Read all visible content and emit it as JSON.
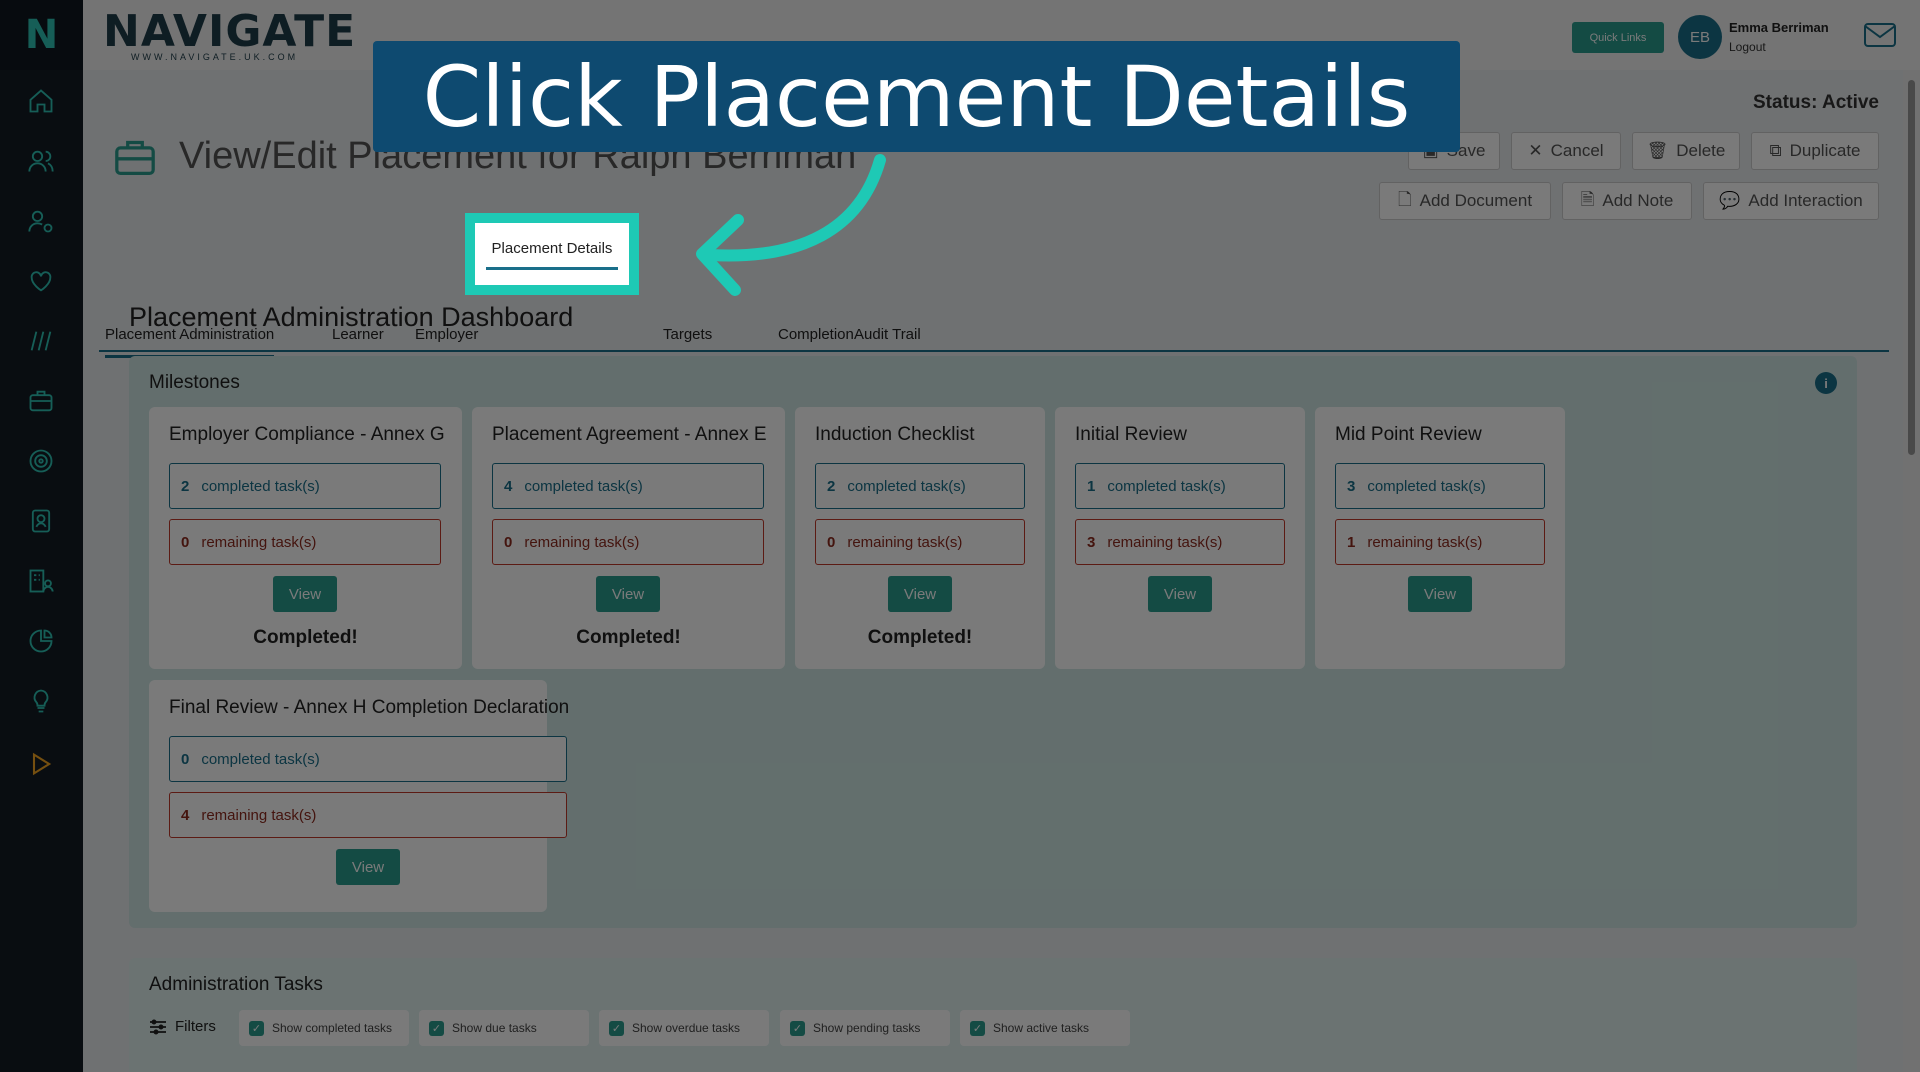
{
  "app": {
    "logo_letter": "N",
    "brand_name": "NAVIGATE",
    "brand_url": "WWW.NAVIGATE.UK.COM"
  },
  "header": {
    "quick_links": "Quick Links",
    "avatar_initials": "EB",
    "user_name": "Emma Berriman",
    "logout": "Logout"
  },
  "sidebar": {
    "icons": [
      "home-icon",
      "users-icon",
      "user-settings-icon",
      "heart-icon",
      "lines-icon",
      "briefcase-icon",
      "target-icon",
      "contact-card-icon",
      "building-user-icon",
      "pie-chart-icon",
      "lightbulb-icon",
      "play-icon"
    ]
  },
  "page": {
    "status": "Status: Active",
    "title": "View/Edit Placement for Ralph Berriman",
    "actions": {
      "save": "Save",
      "cancel": "Cancel",
      "delete": "Delete",
      "duplicate": "Duplicate",
      "add_document": "Add Document",
      "add_note": "Add Note",
      "add_interaction": "Add Interaction"
    },
    "tabs": [
      "Placement Administration",
      "Learner",
      "Employer",
      "Placement Details",
      "Targets",
      "Completion",
      "Audit Trail"
    ]
  },
  "dashboard": {
    "title": "Placement Administration Dashboard",
    "milestones_title": "Milestones",
    "info_icon": "i",
    "cards": [
      {
        "title": "Employer Compliance - Annex G",
        "completed": "2",
        "remaining": "0",
        "status": "Completed!"
      },
      {
        "title": "Placement Agreement - Annex E",
        "completed": "4",
        "remaining": "0",
        "status": "Completed!"
      },
      {
        "title": "Induction Checklist",
        "completed": "2",
        "remaining": "0",
        "status": "Completed!"
      },
      {
        "title": "Initial Review",
        "completed": "1",
        "remaining": "3",
        "status": ""
      },
      {
        "title": "Mid Point Review",
        "completed": "3",
        "remaining": "1",
        "status": ""
      },
      {
        "title": "Final Review - Annex H Completion Declaration",
        "completed": "0",
        "remaining": "4",
        "status": ""
      }
    ],
    "completed_label": "completed task(s)",
    "remaining_label": "remaining task(s)",
    "view_label": "View"
  },
  "admin_tasks": {
    "title": "Administration Tasks",
    "filters_label": "Filters",
    "filters": [
      "Show completed tasks",
      "Show due tasks",
      "Show overdue tasks",
      "Show pending tasks",
      "Show active tasks"
    ]
  },
  "callout": {
    "text": "Click Placement Details"
  },
  "colors": {
    "accent": "#2a9d8f",
    "teal_dark": "#1a6f8a",
    "highlight": "#1ec9b5",
    "callout_bg": "#0e4a70",
    "danger": "#c0392b",
    "sidebar": "#141c24"
  }
}
